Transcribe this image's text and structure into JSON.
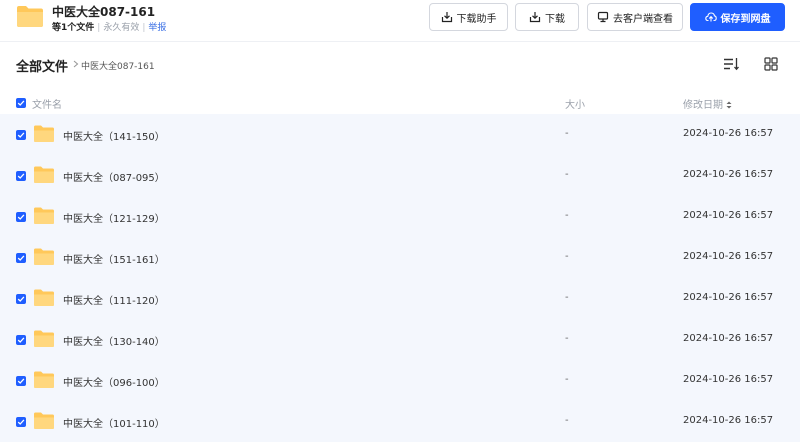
{
  "header": {
    "title": "中医大全087-161",
    "file_count": "等1个文件",
    "validity": "永久有效",
    "report": "举报",
    "buttons": {
      "download_helper": "下载助手",
      "download": "下载",
      "open_client": "去客户端查看",
      "save_to_drive": "保存到网盘"
    }
  },
  "breadcrumb": {
    "root": "全部文件",
    "current": "中医大全087-161"
  },
  "table": {
    "columns": {
      "name": "文件名",
      "size": "大小",
      "modified": "修改日期"
    },
    "rows": [
      {
        "name": "中医大全（141-150）",
        "size": "-",
        "date": "2024-10-26 16:57"
      },
      {
        "name": "中医大全（087-095）",
        "size": "-",
        "date": "2024-10-26 16:57"
      },
      {
        "name": "中医大全（121-129）",
        "size": "-",
        "date": "2024-10-26 16:57"
      },
      {
        "name": "中医大全（151-161）",
        "size": "-",
        "date": "2024-10-26 16:57"
      },
      {
        "name": "中医大全（111-120）",
        "size": "-",
        "date": "2024-10-26 16:57"
      },
      {
        "name": "中医大全（130-140）",
        "size": "-",
        "date": "2024-10-26 16:57"
      },
      {
        "name": "中医大全（096-100）",
        "size": "-",
        "date": "2024-10-26 16:57"
      },
      {
        "name": "中医大全（101-110）",
        "size": "-",
        "date": "2024-10-26 16:57"
      }
    ]
  },
  "icons": {
    "folder": "folder-icon",
    "checkbox": "checkbox-checked-icon",
    "download_helper": "download-tray-icon",
    "download": "download-tray-icon",
    "client": "monitor-icon",
    "save": "cloud-upload-icon",
    "list_view": "list-sort-icon",
    "grid_view": "grid-view-icon"
  },
  "colors": {
    "primary": "#1f5eff",
    "folder": "#ffc85a",
    "row_bg": "#f4f7fd",
    "link": "#3a6fe5"
  }
}
